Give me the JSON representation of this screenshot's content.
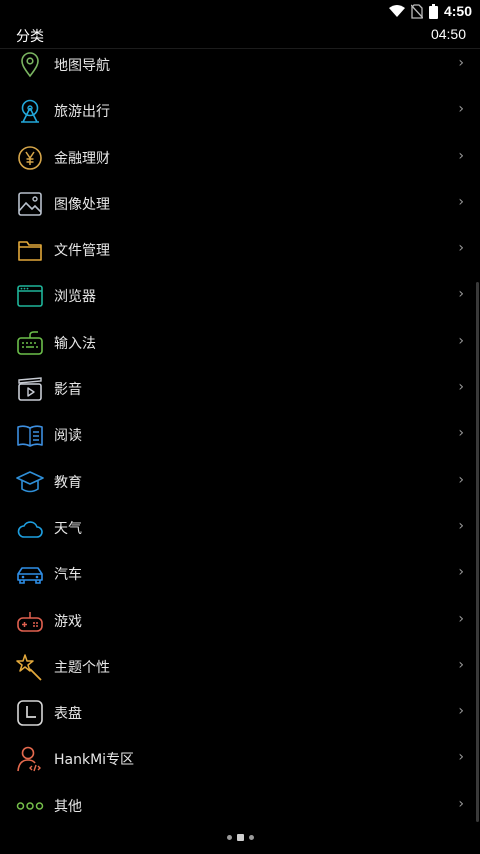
{
  "status": {
    "time": "4:50"
  },
  "header": {
    "title": "分类",
    "clock": "04:50"
  },
  "chevron": "›",
  "items": [
    {
      "label": "地图导航",
      "icon": "map-pin-icon",
      "color": "#7bb661"
    },
    {
      "label": "旅游出行",
      "icon": "ferris-wheel-icon",
      "color": "#22a7d9"
    },
    {
      "label": "金融理财",
      "icon": "yen-coin-icon",
      "color": "#d6a64a"
    },
    {
      "label": "图像处理",
      "icon": "image-icon",
      "color": "#b8c0cc"
    },
    {
      "label": "文件管理",
      "icon": "folder-icon",
      "color": "#e2a83a"
    },
    {
      "label": "浏览器",
      "icon": "browser-window-icon",
      "color": "#1fb59a"
    },
    {
      "label": "输入法",
      "icon": "keyboard-icon",
      "color": "#6cbf4b"
    },
    {
      "label": "影音",
      "icon": "video-player-icon",
      "color": "#c8ccd4"
    },
    {
      "label": "阅读",
      "icon": "open-book-icon",
      "color": "#3d8fe0"
    },
    {
      "label": "教育",
      "icon": "graduation-cap-icon",
      "color": "#2f8fd8"
    },
    {
      "label": "天气",
      "icon": "cloud-icon",
      "color": "#1e9fe0"
    },
    {
      "label": "汽车",
      "icon": "car-icon",
      "color": "#2f8fe8"
    },
    {
      "label": "游戏",
      "icon": "gamepad-icon",
      "color": "#e0604f"
    },
    {
      "label": "主题个性",
      "icon": "magic-wand-icon",
      "color": "#e3a93c"
    },
    {
      "label": "表盘",
      "icon": "clock-icon",
      "color": "#d6d6d6"
    },
    {
      "label": "HankMi专区",
      "icon": "developer-user-icon",
      "color": "#e56a4e"
    },
    {
      "label": "其他",
      "icon": "more-dots-icon",
      "color": "#76c04a"
    }
  ]
}
